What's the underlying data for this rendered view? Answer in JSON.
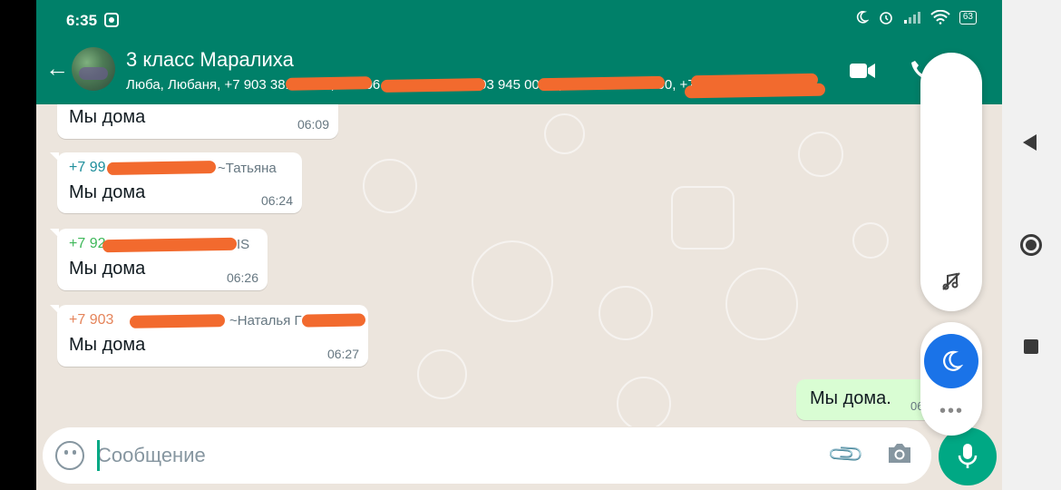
{
  "status_bar": {
    "time": "6:35",
    "battery": "63"
  },
  "header": {
    "title": "3  класс Маралиха",
    "subtitle": "Люба, Любаня, +7 903 381 36 91, +7 906 000 00 12, +7 903 945 00 00, +7 913 000 00 00, +7 906"
  },
  "messages": [
    {
      "text": "Мы дома",
      "time": "06:09"
    },
    {
      "sender_phone": "+7 99",
      "sender_name": "~Татьяна",
      "text": "Мы дома",
      "time": "06:24"
    },
    {
      "sender_phone": "+7 92",
      "sender_name": "IS",
      "text": "Мы дома",
      "time": "06:26"
    },
    {
      "sender_phone": "+7 903",
      "sender_name": "~Наталья Г",
      "text": "Мы дома",
      "time": "06:27"
    }
  ],
  "outgoing": {
    "text": "Мы дома.",
    "time": "06"
  },
  "composer": {
    "placeholder": "Сообщение"
  },
  "colors": {
    "header": "#008069",
    "accent": "#00a884",
    "outgoing": "#d9fdd3",
    "redaction": "#f26a2e",
    "sender2": "#1f8f9c",
    "sender3": "#3fb85a",
    "sender4": "#e5845a"
  },
  "icons": [
    "back-arrow-icon",
    "video-call-icon",
    "phone-icon",
    "emoji-icon",
    "attach-icon",
    "camera-icon",
    "mic-icon",
    "moon-icon",
    "music-off-icon",
    "more-icon"
  ]
}
